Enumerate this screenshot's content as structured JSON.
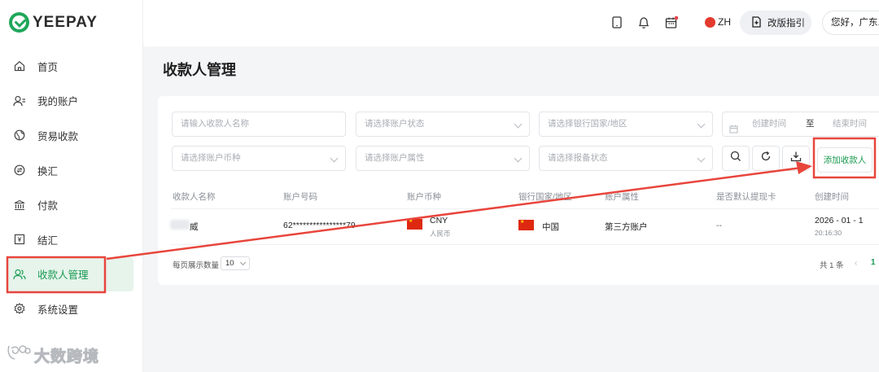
{
  "brand": {
    "name": "YEEPAY"
  },
  "sidebar": {
    "items": [
      {
        "label": "首页",
        "icon": "home-icon"
      },
      {
        "label": "我的账户",
        "icon": "account-icon"
      },
      {
        "label": "贸易收款",
        "icon": "globe-icon"
      },
      {
        "label": "换汇",
        "icon": "exchange-icon"
      },
      {
        "label": "付款",
        "icon": "bank-icon"
      },
      {
        "label": "结汇",
        "icon": "settlement-icon"
      },
      {
        "label": "收款人管理",
        "icon": "payee-icon",
        "active": true
      },
      {
        "label": "系统设置",
        "icon": "gear-icon"
      }
    ]
  },
  "header": {
    "lang": "ZH",
    "guide_label": "改版指引",
    "user_greeting": "您好，广东..."
  },
  "page": {
    "title": "收款人管理"
  },
  "filters": {
    "payee_name": "请输入收款人名称",
    "account_status": "请选择账户状态",
    "bank_country": "请选择银行国家/地区",
    "start_time": "创建时间",
    "range_sep": "至",
    "end_time": "结束时间",
    "currency": "请选择账户币种",
    "account_attr": "请选择账户属性",
    "filing_status": "请选择报备状态"
  },
  "actions": {
    "add_payee": "添加收款人"
  },
  "table": {
    "headers": [
      "收款人名称",
      "账户号码",
      "账户币种",
      "银行国家/地区",
      "账户属性",
      "是否默认提现卡",
      "创建时间"
    ],
    "rows": [
      {
        "name": "威",
        "account": "62****************79",
        "currency_code": "CNY",
        "currency_name": "人民币",
        "country": "中国",
        "attribute": "第三方账户",
        "default_card": "--",
        "created_date": "2026 - 01 - 1",
        "created_time": "20:16:30"
      }
    ]
  },
  "pagination": {
    "page_size_label": "每页展示数量",
    "page_size": "10",
    "total": "共 1 条",
    "prev": "‹",
    "current": "1"
  },
  "watermark": {
    "text": "大数跨境"
  },
  "colors": {
    "accent": "#1a9a52",
    "annotation": "#e8453c",
    "active_bg": "#e6f4ec"
  }
}
